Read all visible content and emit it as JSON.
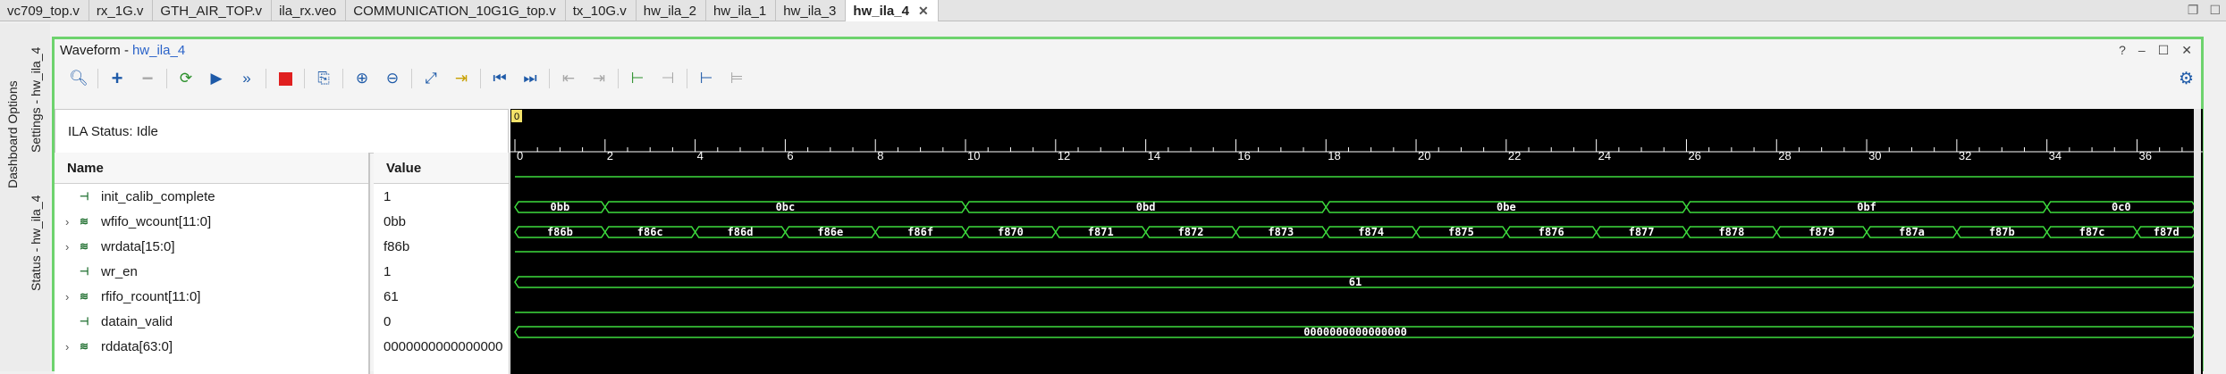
{
  "file_tabs": [
    {
      "label": "vc709_top.v",
      "active": false
    },
    {
      "label": "rx_1G.v",
      "active": false
    },
    {
      "label": "GTH_AIR_TOP.v",
      "active": false
    },
    {
      "label": "ila_rx.veo",
      "active": false
    },
    {
      "label": "COMMUNICATION_10G1G_top.v",
      "active": false
    },
    {
      "label": "tx_10G.v",
      "active": false
    },
    {
      "label": "hw_ila_2",
      "active": false
    },
    {
      "label": "hw_ila_1",
      "active": false
    },
    {
      "label": "hw_ila_3",
      "active": false
    },
    {
      "label": "hw_ila_4",
      "active": true
    }
  ],
  "side_tabs": {
    "dashboard": "Dashboard Options",
    "settings": "Settings - hw_ila_4",
    "status": "Status - hw_ila_4"
  },
  "panel": {
    "title": "Waveform -",
    "subtitle": "hw_ila_4",
    "help": "?",
    "minimize": "–",
    "restore": "☐",
    "close": "✕"
  },
  "ila_status": "ILA Status:  Idle",
  "columns": {
    "name": "Name",
    "value": "Value"
  },
  "signals": [
    {
      "name": "init_calib_complete",
      "value": "1",
      "bus": false
    },
    {
      "name": "wfifo_wcount[11:0]",
      "value": "0bb",
      "bus": true
    },
    {
      "name": "wrdata[15:0]",
      "value": "f86b",
      "bus": true
    },
    {
      "name": "wr_en",
      "value": "1",
      "bus": false
    },
    {
      "name": "rfifo_rcount[11:0]",
      "value": "61",
      "bus": true
    },
    {
      "name": "datain_valid",
      "value": "0",
      "bus": false
    },
    {
      "name": "rddata[63:0]",
      "value": "0000000000000000",
      "bus": true
    }
  ],
  "wave": {
    "cursor_marker": "0",
    "time_ticks": [
      "0",
      "2",
      "4",
      "6",
      "8",
      "10",
      "12",
      "14",
      "16",
      "18",
      "20",
      "22",
      "24",
      "26",
      "28",
      "30",
      "32",
      "34",
      "36"
    ],
    "time_max": 37.3,
    "lines": {
      "init_calib_complete": 1,
      "wr_en": 1,
      "datain_valid": 0
    },
    "buses": {
      "wfifo_wcount": [
        {
          "from": 0,
          "to": 2,
          "text": "0bb"
        },
        {
          "from": 2,
          "to": 10,
          "text": "0bc"
        },
        {
          "from": 10,
          "to": 18,
          "text": "0bd"
        },
        {
          "from": 18,
          "to": 26,
          "text": "0be"
        },
        {
          "from": 26,
          "to": 34,
          "text": "0bf"
        },
        {
          "from": 34,
          "to": 37.3,
          "text": "0c0"
        }
      ],
      "wrdata": [
        {
          "from": 0,
          "to": 2,
          "text": "f86b"
        },
        {
          "from": 2,
          "to": 4,
          "text": "f86c"
        },
        {
          "from": 4,
          "to": 6,
          "text": "f86d"
        },
        {
          "from": 6,
          "to": 8,
          "text": "f86e"
        },
        {
          "from": 8,
          "to": 10,
          "text": "f86f"
        },
        {
          "from": 10,
          "to": 12,
          "text": "f870"
        },
        {
          "from": 12,
          "to": 14,
          "text": "f871"
        },
        {
          "from": 14,
          "to": 16,
          "text": "f872"
        },
        {
          "from": 16,
          "to": 18,
          "text": "f873"
        },
        {
          "from": 18,
          "to": 20,
          "text": "f874"
        },
        {
          "from": 20,
          "to": 22,
          "text": "f875"
        },
        {
          "from": 22,
          "to": 24,
          "text": "f876"
        },
        {
          "from": 24,
          "to": 26,
          "text": "f877"
        },
        {
          "from": 26,
          "to": 28,
          "text": "f878"
        },
        {
          "from": 28,
          "to": 30,
          "text": "f879"
        },
        {
          "from": 30,
          "to": 32,
          "text": "f87a"
        },
        {
          "from": 32,
          "to": 34,
          "text": "f87b"
        },
        {
          "from": 34,
          "to": 36,
          "text": "f87c"
        },
        {
          "from": 36,
          "to": 37.3,
          "text": "f87d"
        }
      ],
      "rfifo_rcount": [
        {
          "from": 0,
          "to": 37.3,
          "text": "61"
        }
      ],
      "rddata": [
        {
          "from": 0,
          "to": 37.3,
          "text": "0000000000000000"
        }
      ]
    },
    "colors": {
      "background": "#000000",
      "trace": "#3ddc3d",
      "text": "#ffffff",
      "marker": "#f3e26a"
    }
  }
}
